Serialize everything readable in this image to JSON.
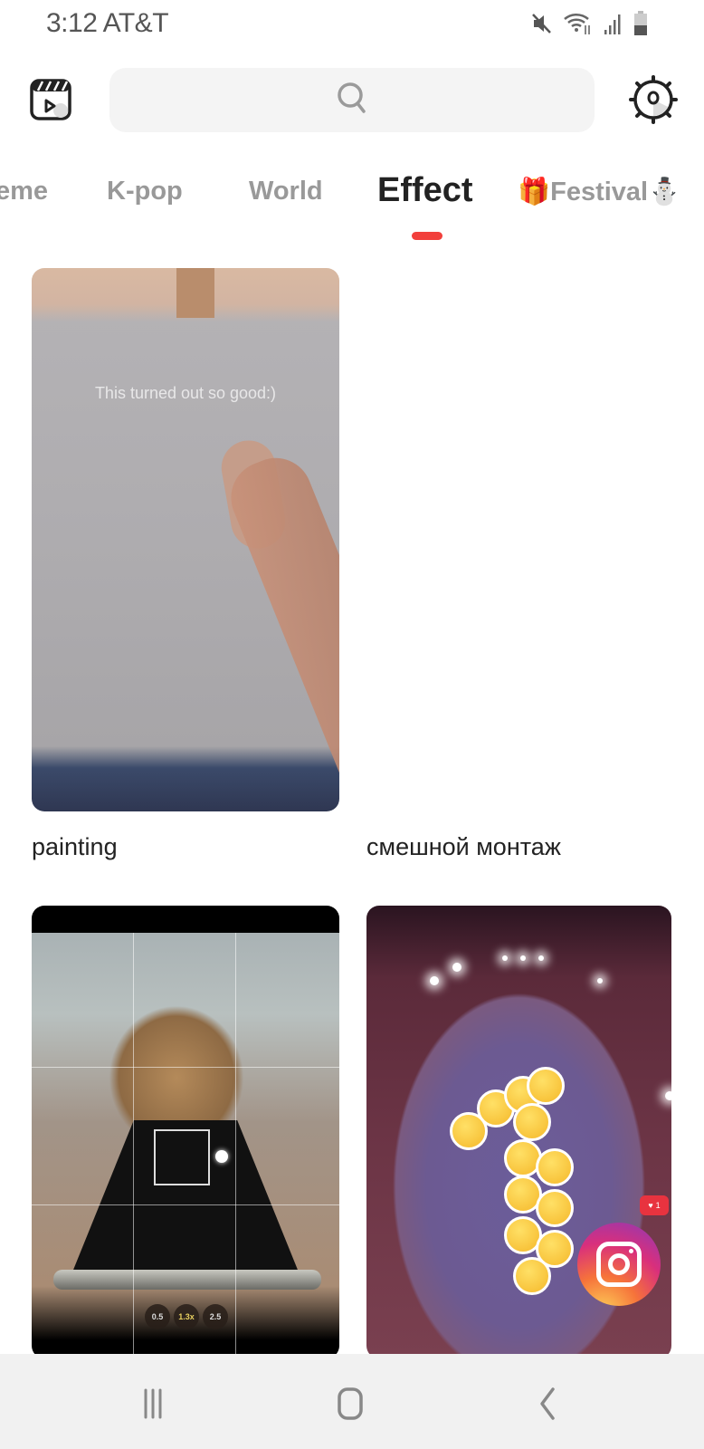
{
  "status_bar": {
    "time": "3:12",
    "carrier": "AT&T",
    "icons": [
      "mute-icon",
      "wifi-icon",
      "signal-icon",
      "battery-icon"
    ]
  },
  "header": {
    "left_icon": "video-clip-icon",
    "search": {
      "placeholder": "",
      "icon": "search-icon"
    },
    "right_icon": "gear-icon"
  },
  "tabs": {
    "items": [
      {
        "label": "eme",
        "active": false
      },
      {
        "label": "K-pop",
        "active": false
      },
      {
        "label": "World",
        "active": false
      },
      {
        "label": "Effect",
        "active": true
      },
      {
        "label": "🎁Festival⛄",
        "active": false
      }
    ],
    "accent_color": "#f2403c"
  },
  "templates": [
    {
      "title": "painting",
      "overlay_text": "This turned out so good:)"
    },
    {
      "title": "смешной монтаж"
    },
    {
      "title": "",
      "camera_zoom_options": [
        "0.5",
        "1.3x",
        "2.5"
      ],
      "selected_zoom": "1.3x"
    },
    {
      "title": "",
      "like_count": "1"
    }
  ],
  "nav_bar": {
    "buttons": [
      "recent-apps-icon",
      "home-icon",
      "back-icon"
    ]
  }
}
